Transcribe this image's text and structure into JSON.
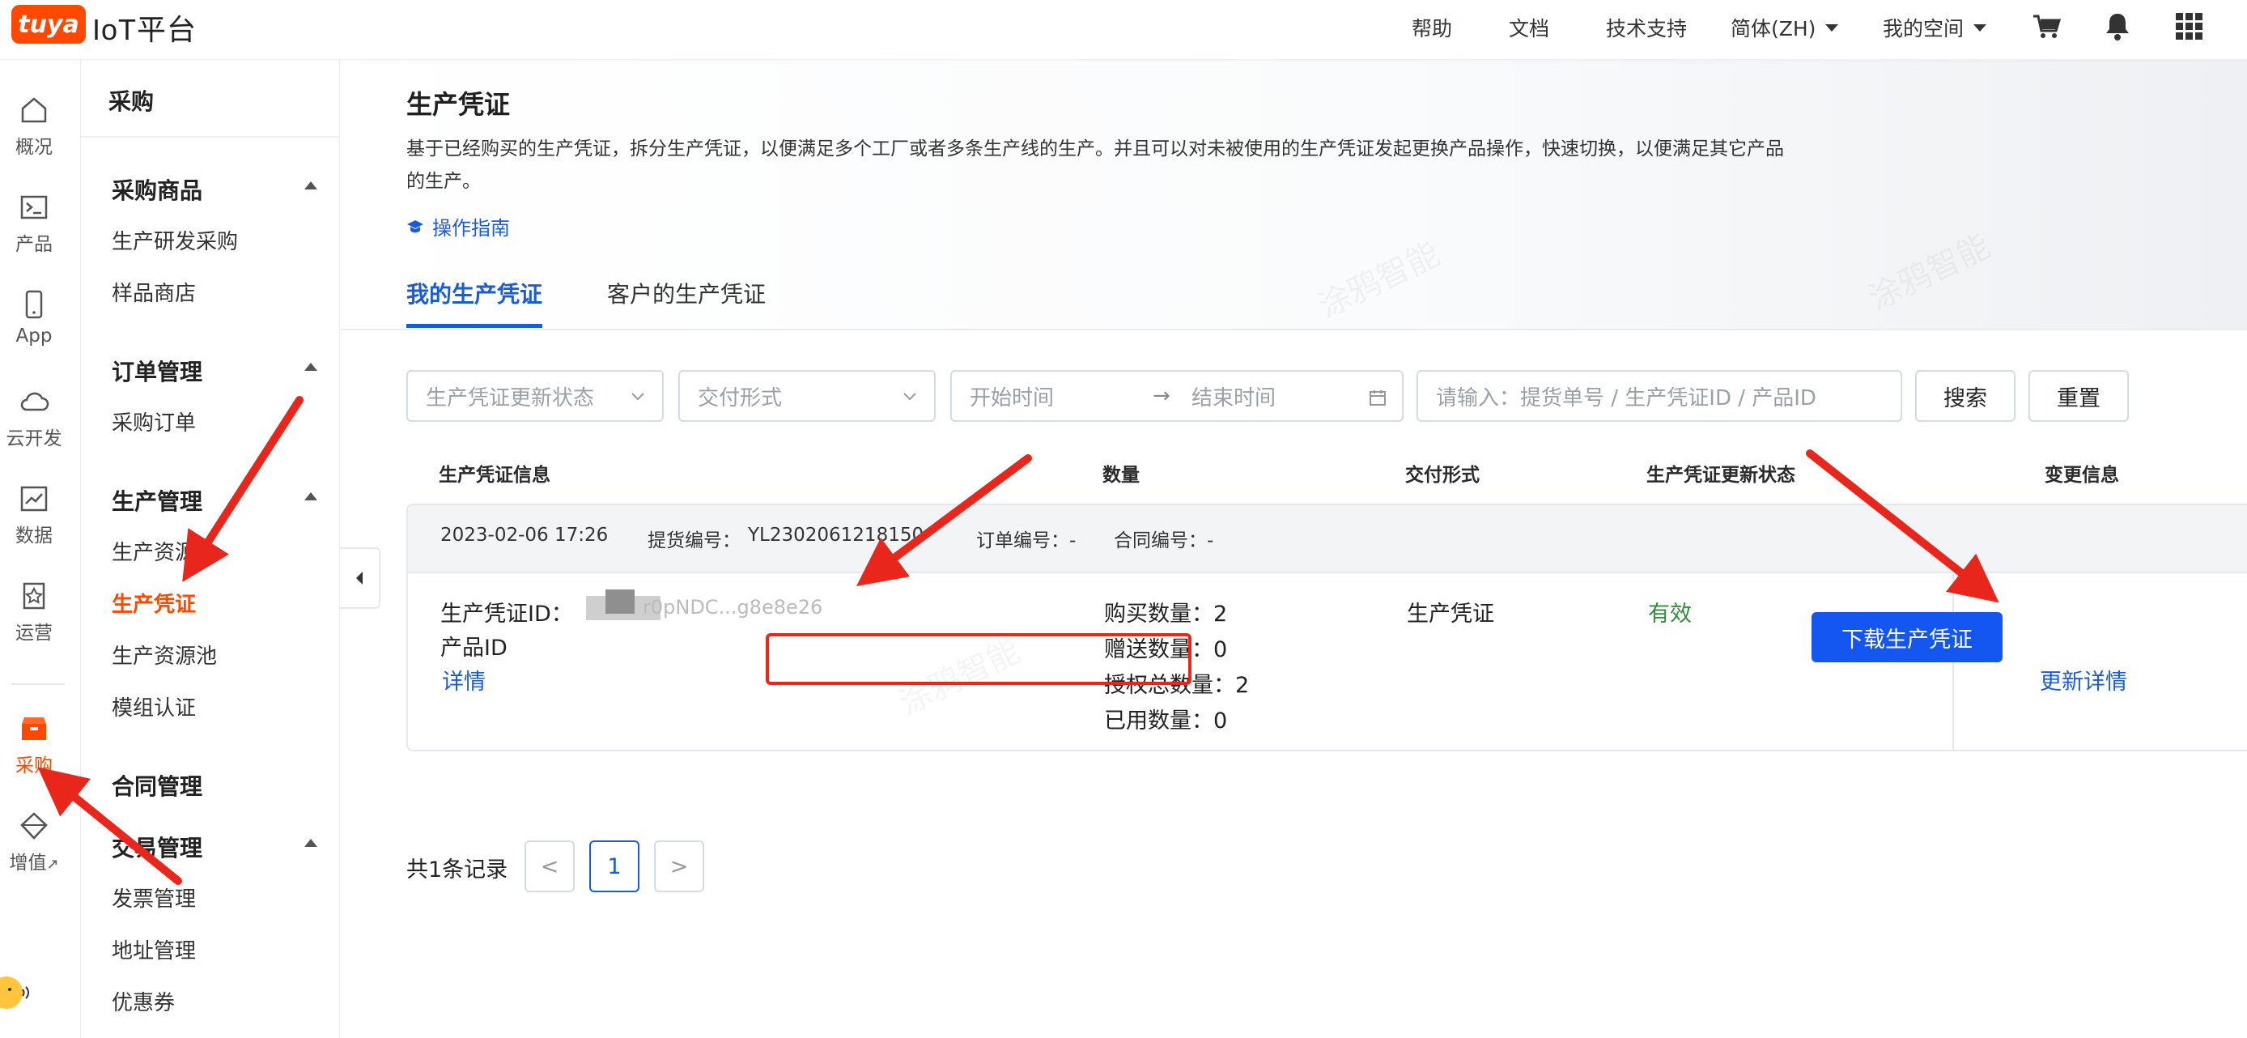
{
  "topbar": {
    "logo_text": "tuya",
    "title": "IoT平台",
    "nav": [
      "帮助",
      "文档",
      "技术支持"
    ],
    "language": "简体(ZH)",
    "workspace": "我的空间",
    "icons": [
      "cart-icon",
      "bell-icon",
      "apps-grid-icon"
    ]
  },
  "rail": {
    "items": [
      {
        "label": "概况",
        "icon": "home-icon"
      },
      {
        "label": "产品",
        "icon": "terminal-icon"
      },
      {
        "label": "App",
        "icon": "phone-icon"
      },
      {
        "label": "云开发",
        "icon": "cloud-icon"
      },
      {
        "label": "数据",
        "icon": "chart-icon"
      },
      {
        "label": "运营",
        "icon": "award-icon"
      },
      {
        "label": "采购",
        "icon": "box-icon"
      },
      {
        "label": "增值",
        "icon": "diamond-icon"
      }
    ],
    "external_mark": "↗"
  },
  "sidebar": {
    "header": "采购",
    "groups": {
      "purchase_goods": "采购商品",
      "order_mgmt": "订单管理",
      "production_mgmt": "生产管理",
      "contract_mgmt": "合同管理",
      "trade_mgmt": "交易管理"
    },
    "links": {
      "rd_purchase": "生产研发采购",
      "sample_store": "样品商店",
      "purchase_order": "采购订单",
      "production_resource": "生产资源",
      "production_voucher": "生产凭证",
      "resource_pool": "生产资源池",
      "module_cert": "模组认证",
      "invoice_mgmt": "发票管理",
      "address_mgmt": "地址管理",
      "coupon": "优惠券"
    }
  },
  "page": {
    "title": "生产凭证",
    "description": "基于已经购买的生产凭证，拆分生产凭证，以便满足多个工厂或者多条生产线的生产。并且可以对未被使用的生产凭证发起更换产品操作，快速切换，以便满足其它产品的生产。",
    "guide_link": "操作指南",
    "tabs": [
      "我的生产凭证",
      "客户的生产凭证"
    ]
  },
  "filters": {
    "status_placeholder": "生产凭证更新状态",
    "delivery_placeholder": "交付形式",
    "start_placeholder": "开始时间",
    "range_arrow": "→",
    "end_placeholder": "结束时间",
    "search_placeholder": "请输入：提货单号 / 生产凭证ID / 产品ID",
    "search_button": "搜索",
    "reset_button": "重置"
  },
  "table": {
    "headers": [
      "生产凭证信息",
      "数量",
      "交付形式",
      "生产凭证更新状态",
      "变更信息"
    ],
    "row": {
      "date": "2023-02-06 17:26",
      "pickup_label": "提货编号：",
      "pickup_value": "YL2302061218150",
      "order_label": "订单编号：-",
      "contract_label": "合同编号：-",
      "voucher_id_label": "生产凭证ID：",
      "voucher_id_visible": "r0pNDC...g8e8e26",
      "product_id_label": "产品ID",
      "detail_link": "详情",
      "qty_purchase": "购买数量：2",
      "qty_gift": "赠送数量：0",
      "qty_total": "授权总数量：2",
      "qty_used": "已用数量：0",
      "delivery": "生产凭证",
      "status": "有效",
      "download_button": "下载生产凭证",
      "update_detail_link": "更新详情"
    }
  },
  "pagination": {
    "total": "共1条记录",
    "prev": "<",
    "current": "1",
    "next": ">"
  },
  "colors": {
    "brand": "#ff4800",
    "primary": "#1456f0",
    "link": "#1a5cd8",
    "success": "#2f8f3a",
    "annotation": "#e8261c"
  }
}
